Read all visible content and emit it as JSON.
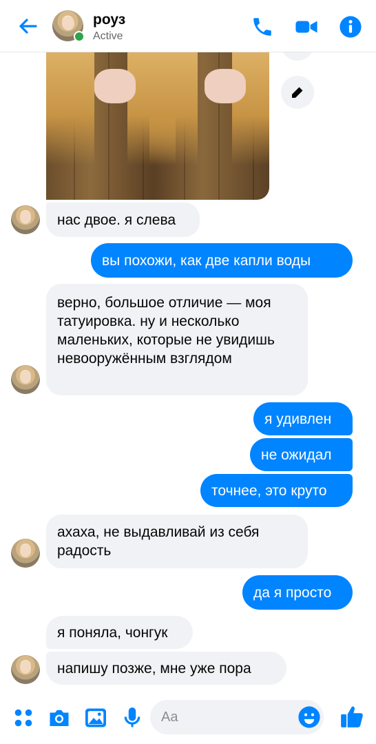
{
  "header": {
    "name": "роуз",
    "status": "Active"
  },
  "colors": {
    "accent": "#0084ff",
    "incoming_bubble": "#f0f2f5",
    "active": "#31a24c"
  },
  "messages": [
    {
      "from": "them",
      "text": "нас двое. я слева"
    },
    {
      "from": "me",
      "text": "вы похожи, как две капли воды"
    },
    {
      "from": "them",
      "text": "верно, большое отличие — моя татуировка. ну и несколько маленьких, которые не увидишь невооружённым взглядом"
    },
    {
      "from": "me",
      "text": "я удивлен"
    },
    {
      "from": "me",
      "text": "не ожидал"
    },
    {
      "from": "me",
      "text": "точнее, это круто"
    },
    {
      "from": "them",
      "text": "ахаха, не выдавливай из себя радость"
    },
    {
      "from": "me",
      "text": "да я просто"
    },
    {
      "from": "them",
      "text": "я поняла, чонгук"
    },
    {
      "from": "them",
      "text": "напишу позже, мне уже пора"
    }
  ],
  "composer": {
    "placeholder": "Aa"
  },
  "icons": {
    "back": "arrow-left-icon",
    "call": "phone-icon",
    "video": "video-camera-icon",
    "info": "info-icon",
    "edit": "pencil-icon",
    "apps": "four-dots-icon",
    "camera": "camera-icon",
    "gallery": "image-icon",
    "mic": "microphone-icon",
    "emoji": "smiley-icon",
    "like": "thumbs-up-icon"
  }
}
